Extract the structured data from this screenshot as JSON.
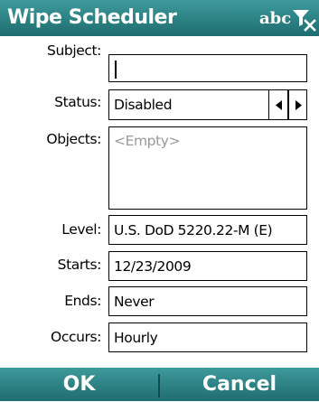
{
  "window": {
    "title": "Wipe Scheduler",
    "input_mode": "abc"
  },
  "form": {
    "subject": {
      "label": "Subject:",
      "value": ""
    },
    "status": {
      "label": "Status:",
      "value": "Disabled"
    },
    "objects": {
      "label": "Objects:",
      "placeholder": "<Empty>"
    },
    "level": {
      "label": "Level:",
      "value": "U.S. DoD 5220.22-M (E)"
    },
    "starts": {
      "label": "Starts:",
      "value": "12/23/2009"
    },
    "ends": {
      "label": "Ends:",
      "value": "Never"
    },
    "occurs": {
      "label": "Occurs:",
      "value": "Hourly"
    }
  },
  "softkeys": {
    "left": "OK",
    "right": "Cancel"
  },
  "colors": {
    "bar": "#2f8587",
    "bar_dark": "#1f6d70",
    "bar_text": "#ffffff"
  },
  "icons": {
    "close": "close-filter-icon",
    "spin_left": "triangle-left-icon",
    "spin_right": "triangle-right-icon"
  }
}
